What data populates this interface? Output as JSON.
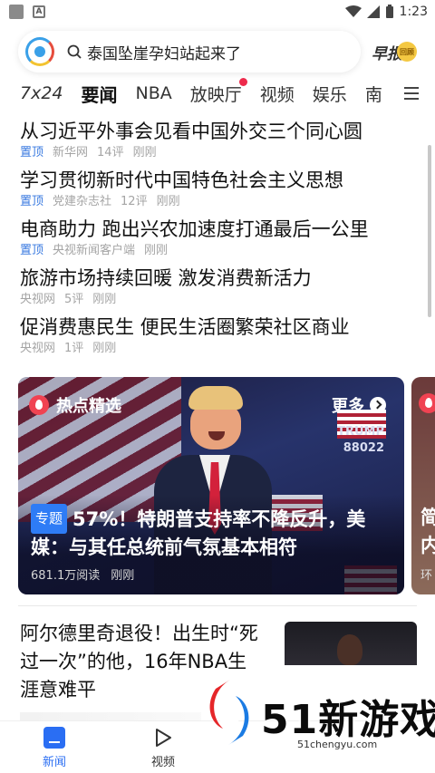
{
  "status_bar": {
    "time": "1:23"
  },
  "search": {
    "query": "泰国坠崖孕妇站起来了",
    "morning_label": "早报",
    "morning_sub": "回顾"
  },
  "tabs": [
    {
      "label": "7x24"
    },
    {
      "label": "要闻"
    },
    {
      "label": "NBA"
    },
    {
      "label": "放映厅"
    },
    {
      "label": "视频"
    },
    {
      "label": "娱乐"
    },
    {
      "label": "南"
    }
  ],
  "headlines": [
    {
      "title": "从习近平外事会见看中国外交三个同心圆",
      "pin": "置顶",
      "source": "新华网",
      "comments": "14评",
      "time": "刚刚"
    },
    {
      "title": "学习贯彻新时代中国特色社会主义思想",
      "pin": "置顶",
      "source": "党建杂志社",
      "comments": "12评",
      "time": "刚刚"
    },
    {
      "title": "电商助力 跑出兴农加速度打通最后一公里",
      "pin": "置顶",
      "source": "央视新闻客户端",
      "time": "刚刚"
    },
    {
      "title": "旅游市场持续回暖 激发消费新活力",
      "source": "央视网",
      "comments": "5评",
      "time": "刚刚"
    },
    {
      "title": "促消费惠民生 便民生活圈繁荣社区商业",
      "source": "央视网",
      "comments": "1评",
      "time": "刚刚"
    }
  ],
  "hot_card": {
    "section": "热点精选",
    "more": "更多",
    "tag": "专题",
    "title": "57%！特朗普支持率不降反升，美媒：与其任总统前气氛基本相符",
    "reads": "681.1万阅读",
    "time": "刚刚",
    "podium_text": "TRUMP\n88022",
    "peek_title": "简\n内",
    "peek_meta": "环"
  },
  "article": {
    "title": "阿尔德里奇退役！出生时“死过一次”的他，16年NBA生涯意难平"
  },
  "bottom_nav": {
    "news": "新闻",
    "video": "视频"
  },
  "watermark": {
    "brand": "51新游戏",
    "url": "51chengyu.com"
  },
  "colors": {
    "accent": "#2a6ef3",
    "pin": "#3a7ae0",
    "red_dot": "#ee2a4c"
  }
}
